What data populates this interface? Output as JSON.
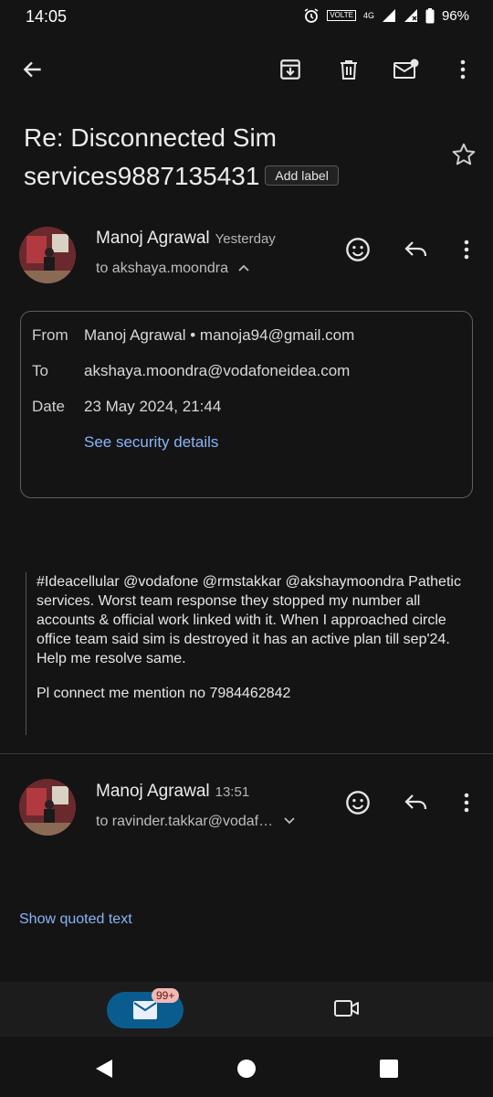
{
  "status": {
    "time": "14:05",
    "volte": "VOLTE",
    "network": "4G",
    "battery": "96%"
  },
  "subject": {
    "text": "Re: Disconnected Sim services9887135431",
    "label_button": "Add label"
  },
  "messages": [
    {
      "sender": "Manoj Agrawal",
      "time": "Yesterday",
      "recipient": "to akshaya.moondra",
      "details": {
        "from_label": "From",
        "from_value": "Manoj Agrawal • manoja94@gmail.com",
        "to_label": "To",
        "to_value": "akshaya.moondra@vodafoneidea.com",
        "date_label": "Date",
        "date_value": "23 May 2024, 21:44",
        "security_link": "See security details"
      },
      "body": [
        "#Ideacellular @vodafone @rmstakkar @akshaymoondra Pathetic services. Worst team response they stopped my number all accounts & official work linked with it. When I approached circle office team said sim is destroyed it has an active plan till sep'24. Help me resolve same.",
        "Pl connect me mention no 7984462842"
      ]
    },
    {
      "sender": "Manoj Agrawal",
      "time": "13:51",
      "recipient": "to ravinder.takkar@vodaf…",
      "quoted_link": "Show quoted text"
    }
  ],
  "bottom_nav": {
    "mail_badge": "99+"
  }
}
